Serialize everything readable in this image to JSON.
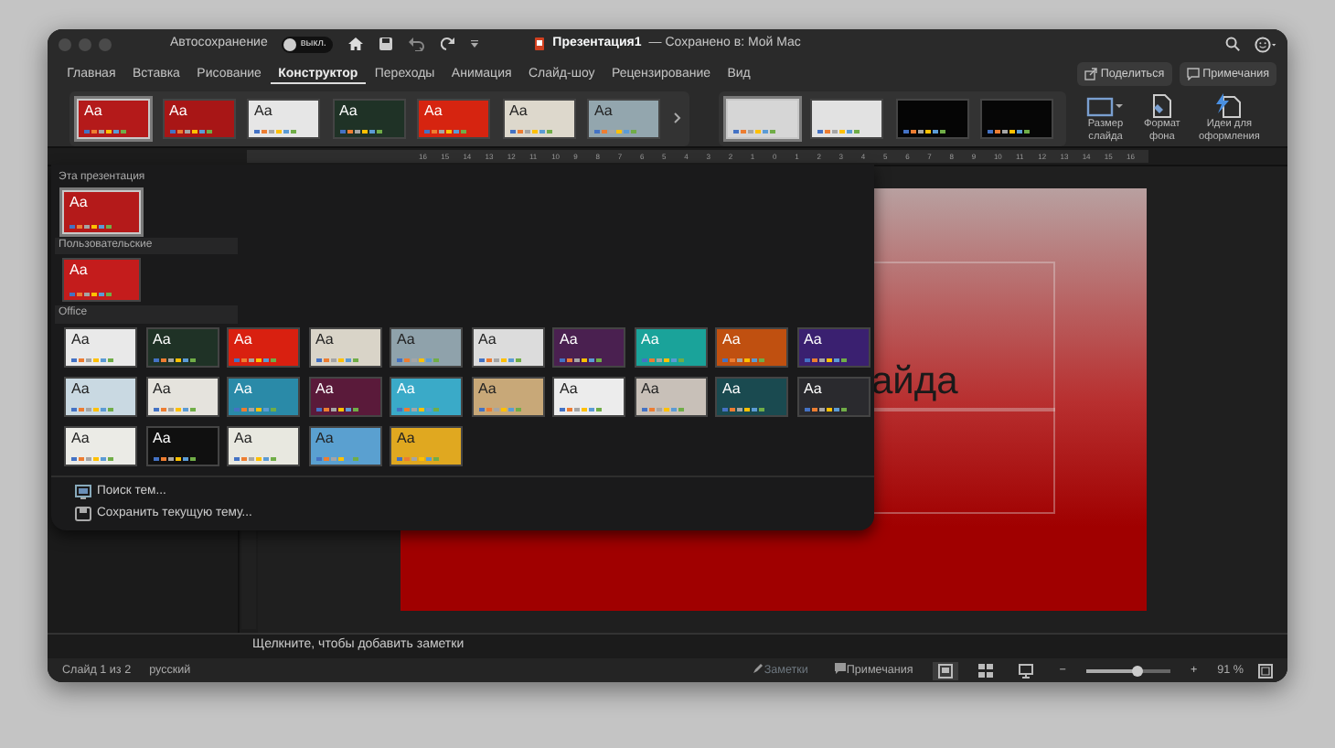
{
  "title_bar": {
    "autosave_label": "Автосохранение",
    "autosave_toggle": {
      "label": "выкл.",
      "on": false
    },
    "document_title": "Презентация1",
    "save_status": "— Сохранено в: Мой Mac"
  },
  "tabs": [
    {
      "label": "Главная",
      "selected": false
    },
    {
      "label": "Вставка",
      "selected": false
    },
    {
      "label": "Рисование",
      "selected": false
    },
    {
      "label": "Конструктор",
      "selected": true
    },
    {
      "label": "Переходы",
      "selected": false
    },
    {
      "label": "Анимация",
      "selected": false
    },
    {
      "label": "Слайд-шоу",
      "selected": false
    },
    {
      "label": "Рецензирование",
      "selected": false
    },
    {
      "label": "Вид",
      "selected": false
    }
  ],
  "share_button": "Поделиться",
  "comments_button": "Примечания",
  "ribbon": {
    "themes": [
      {
        "label": "Aa",
        "color": "#b41a1a",
        "selected": true
      },
      {
        "label": "Aa",
        "color": "#a81616",
        "selected": false
      },
      {
        "label": "Aa",
        "color": "#e6e6e6",
        "selected": false
      },
      {
        "label": "Aa",
        "color": "#1f3226",
        "selected": false
      },
      {
        "label": "Aa",
        "color": "#d62410",
        "selected": false
      },
      {
        "label": "Aa",
        "color": "#ddd8cc",
        "selected": false
      },
      {
        "label": "Aa",
        "color": "#93a6ae",
        "selected": false
      }
    ],
    "variants": [
      {
        "color": "#d6d6d6",
        "selected": true
      },
      {
        "color": "#e2e2e2",
        "selected": false
      },
      {
        "color": "#050505",
        "selected": false
      },
      {
        "color": "#060606",
        "selected": false
      }
    ],
    "tools": [
      {
        "label": "Размер слайда",
        "kind": "slide-size"
      },
      {
        "label": "Формат фона",
        "kind": "format-background"
      },
      {
        "label": "Идеи для оформления",
        "kind": "designer"
      }
    ]
  },
  "ruler": {
    "labels": [
      "16",
      "15",
      "14",
      "13",
      "12",
      "11",
      "10",
      "9",
      "8",
      "7",
      "6",
      "5",
      "4",
      "3",
      "2",
      "1",
      "0",
      "1",
      "2",
      "3",
      "4",
      "5",
      "6",
      "7",
      "8",
      "9",
      "10",
      "11",
      "12",
      "13",
      "14",
      "15",
      "16"
    ]
  },
  "gallery": {
    "sections": [
      {
        "heading": "Эта презентация",
        "banded": false,
        "themes": [
          {
            "label": "Aa",
            "color": "#b41a1a",
            "selected": true
          }
        ]
      },
      {
        "heading": "Пользовательские",
        "banded": true,
        "themes": [
          {
            "label": "Aa",
            "color": "#c41c1c",
            "selected": false
          }
        ]
      },
      {
        "heading": "Office",
        "banded": true,
        "themes": [
          {
            "label": "Aa",
            "color": "#e9e9e9",
            "selected": false
          },
          {
            "label": "Aa",
            "color": "#1f3226",
            "selected": false
          },
          {
            "label": "Aa",
            "color": "#d92010",
            "selected": false
          },
          {
            "label": "Aa",
            "color": "#d9d4c8",
            "selected": false
          },
          {
            "label": "Aa",
            "color": "#8fa2ab",
            "selected": false
          },
          {
            "label": "Aa",
            "color": "#dcdcdc",
            "selected": false
          },
          {
            "label": "Aa",
            "color": "#4a2050",
            "selected": false
          },
          {
            "label": "Aa",
            "color": "#1aa39a",
            "selected": false
          },
          {
            "label": "Aa",
            "color": "#c05010",
            "selected": false
          },
          {
            "label": "Aa",
            "color": "#3a2070",
            "selected": false
          },
          {
            "label": "Aa",
            "color": "#c9d9e2",
            "selected": false
          },
          {
            "label": "Aa",
            "color": "#e5e3dd",
            "selected": false
          },
          {
            "label": "Aa",
            "color": "#2a8aa8",
            "selected": false
          },
          {
            "label": "Aa",
            "color": "#5a1a3a",
            "selected": false
          },
          {
            "label": "Aa",
            "color": "#3aaac8",
            "selected": false
          },
          {
            "label": "Aa",
            "color": "#c8a878",
            "selected": false
          },
          {
            "label": "Aa",
            "color": "#ececec",
            "selected": false
          },
          {
            "label": "Aa",
            "color": "#c8c0b8",
            "selected": false
          },
          {
            "label": "Aa",
            "color": "#1a4a50",
            "selected": false
          },
          {
            "label": "Aa",
            "color": "#2a2a2e",
            "selected": false
          },
          {
            "label": "Aa",
            "color": "#ebebe6",
            "selected": false
          },
          {
            "label": "Aa",
            "color": "#101010",
            "selected": false
          },
          {
            "label": "Aa",
            "color": "#e8e8e0",
            "selected": false
          },
          {
            "label": "Aa",
            "color": "#5aa0d0",
            "selected": false
          },
          {
            "label": "Aa",
            "color": "#e0a820",
            "selected": false
          }
        ]
      }
    ],
    "actions": [
      {
        "label": "Поиск тем...",
        "kind": "browse"
      },
      {
        "label": "Сохранить текущую тему...",
        "kind": "save"
      }
    ]
  },
  "slide": {
    "title_fragment": "айда"
  },
  "notes": {
    "prompt": "Щелкните, чтобы добавить заметки"
  },
  "status_bar": {
    "slide_count": "Слайд 1 из 2",
    "language": "русский",
    "notes_button": "Заметки",
    "comments_button": "Примечания",
    "views": [
      {
        "kind": "normal",
        "selected": true
      },
      {
        "kind": "sorter",
        "selected": false
      },
      {
        "kind": "presenter",
        "selected": false
      }
    ],
    "zoom_out": "−",
    "zoom_in": "+",
    "zoom": {
      "level": 0.6,
      "reading": "91 %"
    }
  }
}
